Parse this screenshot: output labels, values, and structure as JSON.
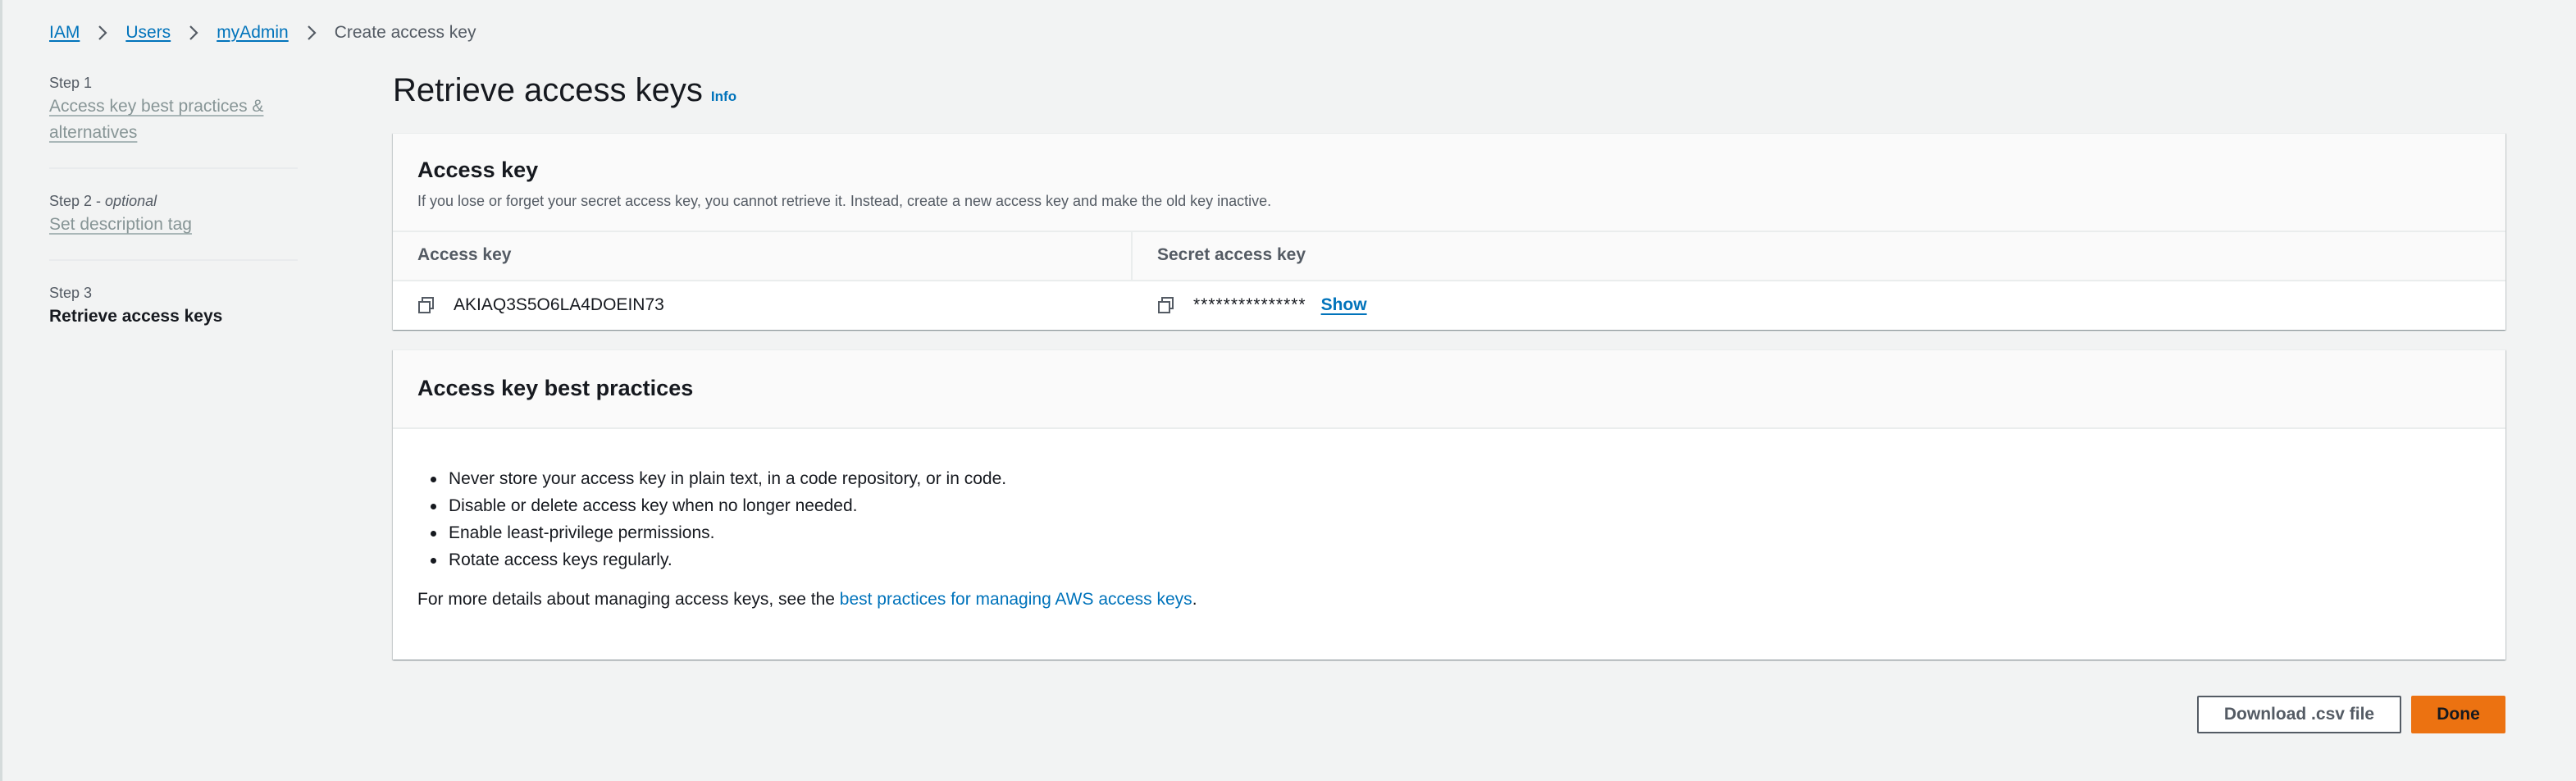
{
  "breadcrumb": {
    "items": [
      "IAM",
      "Users",
      "myAdmin"
    ],
    "current": "Create access key"
  },
  "steps": [
    {
      "label": "Step 1",
      "title": "Access key best practices & alternatives"
    },
    {
      "label": "Step 2 - ",
      "optional": "optional",
      "title": "Set description tag"
    },
    {
      "label": "Step 3",
      "title": "Retrieve access keys"
    }
  ],
  "page": {
    "title": "Retrieve access keys",
    "info": "Info"
  },
  "access_key_card": {
    "title": "Access key",
    "description": "If you lose or forget your secret access key, you cannot retrieve it. Instead, create a new access key and make the old key inactive.",
    "columns": [
      "Access key",
      "Secret access key"
    ],
    "access_key_value": "AKIAQ3S5O6LA4DOEIN73",
    "secret_masked": "***************",
    "show_label": "Show"
  },
  "best_practices_card": {
    "title": "Access key best practices",
    "items": [
      "Never store your access key in plain text, in a code repository, or in code.",
      "Disable or delete access key when no longer needed.",
      "Enable least-privilege permissions.",
      "Rotate access keys regularly."
    ],
    "more_prefix": "For more details about managing access keys, see the ",
    "more_link": "best practices for managing AWS access keys",
    "more_suffix": "."
  },
  "actions": {
    "download_label": "Download .csv file",
    "done_label": "Done"
  },
  "colors": {
    "link": "#0073bb",
    "primary_button": "#ec7211",
    "background": "#f2f3f3"
  }
}
